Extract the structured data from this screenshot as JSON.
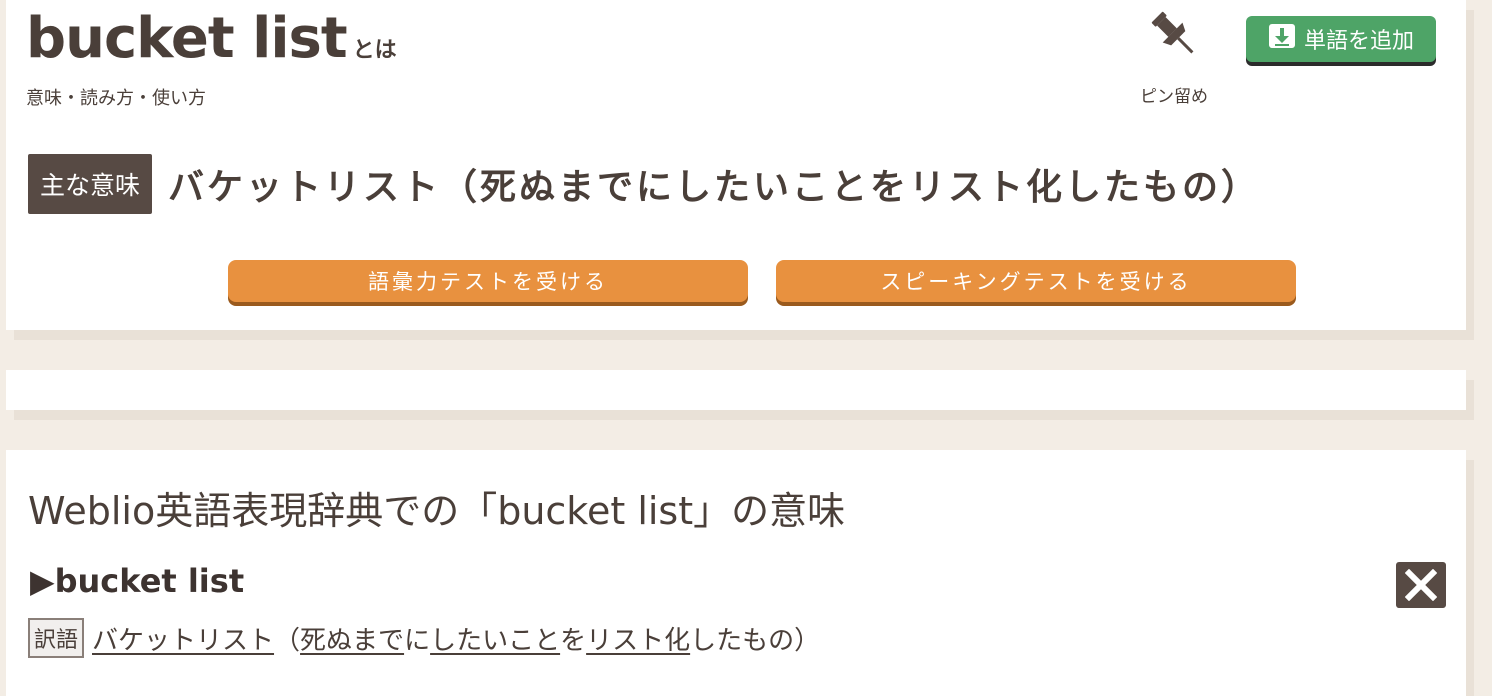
{
  "header": {
    "headword": "bucket list",
    "headword_suffix": "とは",
    "subtitle": "意味・読み方・使い方",
    "pin_label": "ピン留め",
    "add_word_label": "単語を追加"
  },
  "main_meaning": {
    "badge": "主な意味",
    "text": "バケットリスト（死ぬまでにしたいことをリスト化したもの）"
  },
  "tests": {
    "vocab_label": "語彙力テストを受ける",
    "speaking_label": "スピーキングテストを受ける"
  },
  "dictionary": {
    "section_title": "Weblio英語表現辞典での「bucket list」の意味",
    "entry_head": "▶bucket list",
    "yakugo_label": "訳語",
    "translation_parts": [
      {
        "text": "バケットリスト",
        "link": true
      },
      {
        "text": "（",
        "link": false
      },
      {
        "text": "死ぬまで",
        "link": true
      },
      {
        "text": "に",
        "link": false
      },
      {
        "text": "したいこと",
        "link": true
      },
      {
        "text": "を",
        "link": false
      },
      {
        "text": "リスト化",
        "link": true
      },
      {
        "text": "したもの）",
        "link": false
      }
    ]
  },
  "colors": {
    "accent_green": "#4ea467",
    "accent_orange": "#e8913f",
    "badge_brown": "#574a44",
    "text": "#4a3f39"
  },
  "icons": [
    "pushpin-icon",
    "download-icon",
    "close-icon"
  ]
}
